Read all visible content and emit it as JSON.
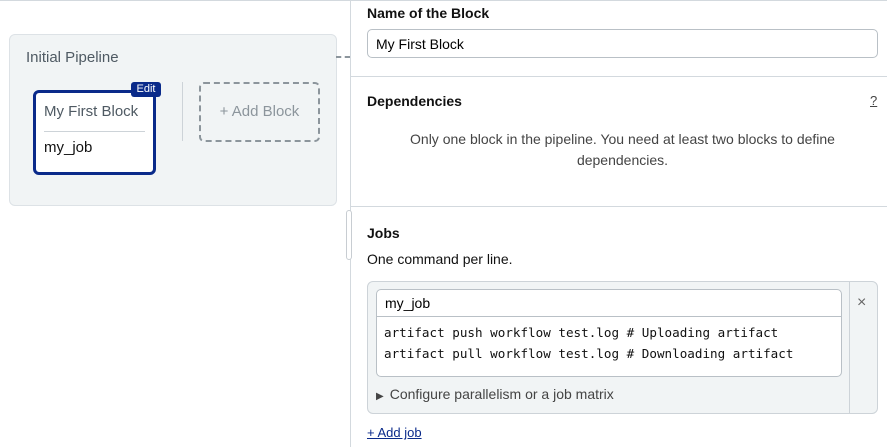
{
  "pipeline": {
    "title": "Initial Pipeline",
    "block": {
      "name": "My First Block",
      "job": "my_job",
      "edit_label": "Edit"
    },
    "add_block_label": "+ Add Block"
  },
  "editor": {
    "name_label": "Name of the Block",
    "name_value": "My First Block",
    "dependencies": {
      "label": "Dependencies",
      "help": "?",
      "message": "Only one block in the pipeline. You need at least two blocks to define dependencies."
    },
    "jobs": {
      "label": "Jobs",
      "hint": "One command per line.",
      "items": [
        {
          "name": "my_job",
          "commands": "artifact push workflow test.log # Uploading artifact\nartifact pull workflow test.log # Downloading artifact",
          "close": "×",
          "config_label": "Configure parallelism or a job matrix"
        }
      ],
      "add_job_label": "+ Add job"
    }
  },
  "colors": {
    "accent": "#0a2a8a"
  }
}
